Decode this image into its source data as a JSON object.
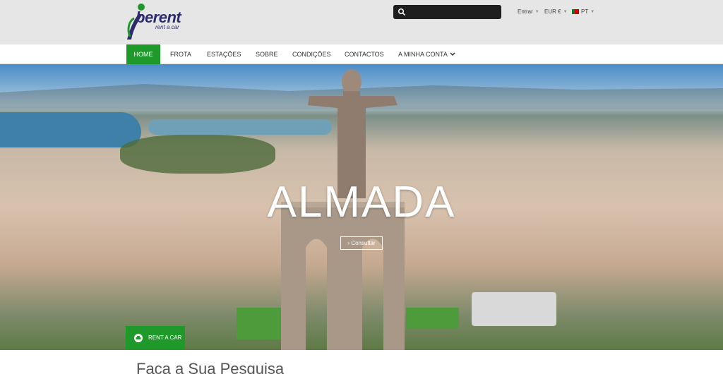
{
  "brand": {
    "name": "berent",
    "tagline": "rent a car",
    "colors": {
      "primary": "#1f9a2a",
      "logo": "#2e2a6e"
    }
  },
  "header": {
    "search_placeholder": "",
    "login_label": "Entrar",
    "currency_label": "EUR €",
    "language_label": "PT"
  },
  "nav": {
    "items": [
      {
        "label": "HOME",
        "active": true
      },
      {
        "label": "FROTA",
        "active": false
      },
      {
        "label": "ESTAÇÕES",
        "active": false
      },
      {
        "label": "SOBRE",
        "active": false
      },
      {
        "label": "CONDIÇÕES",
        "active": false
      },
      {
        "label": "CONTACTOS",
        "active": false
      },
      {
        "label": "A MINHA CONTA",
        "active": false
      }
    ]
  },
  "hero": {
    "title": "ALMADA",
    "button_label": "Consultar",
    "rent_button_label": "RENT A CAR"
  },
  "search_section": {
    "title": "Faça a Sua Pesquisa"
  },
  "icons": {
    "search": "search-icon",
    "car": "car-icon",
    "chevron": "chevron-down-icon",
    "flag": "portugal-flag-icon"
  }
}
